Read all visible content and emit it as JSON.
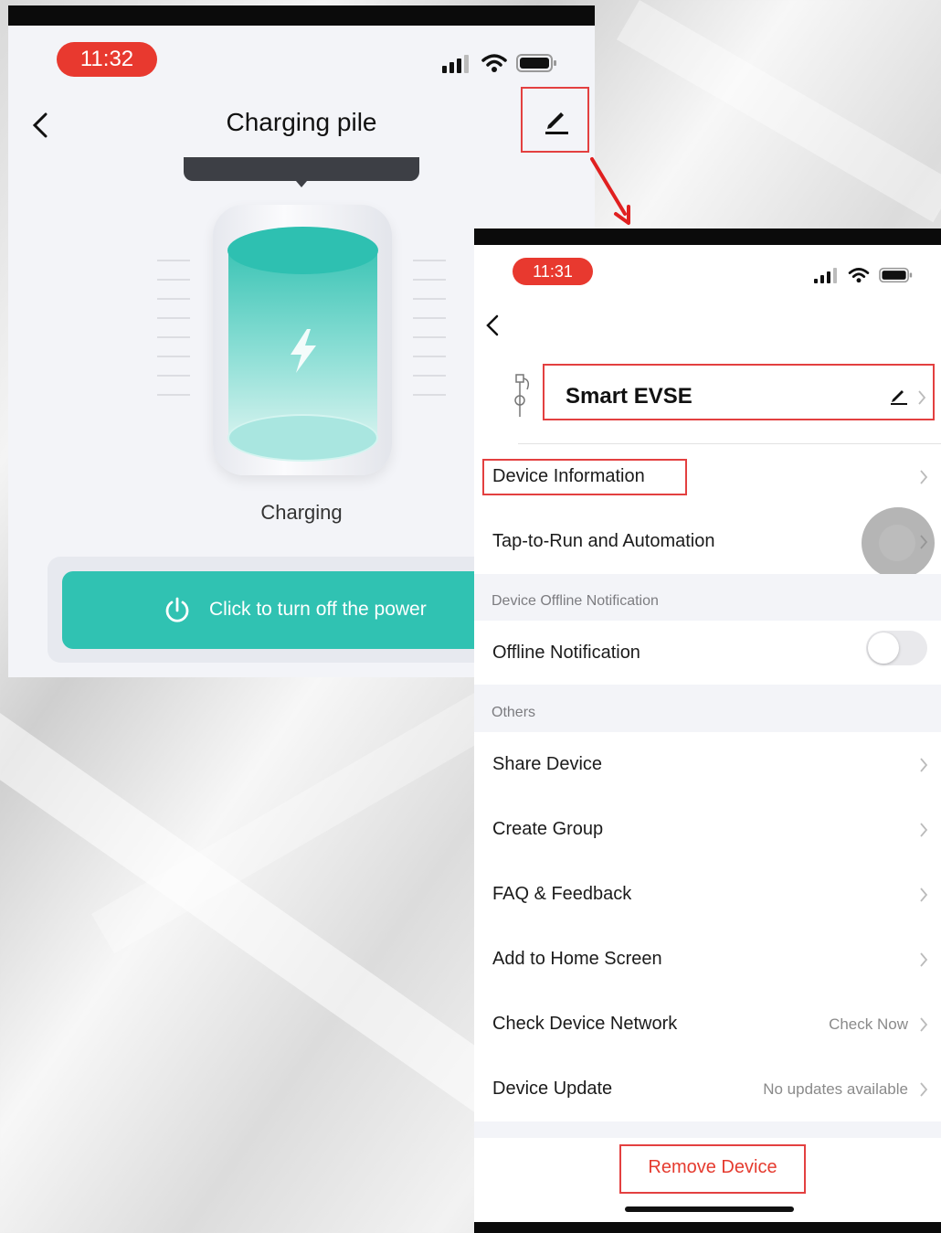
{
  "left_screen": {
    "time": "11:32",
    "title": "Charging pile",
    "status_label": "Charging",
    "power_button_label": "Click to turn off the power",
    "icons": [
      "back-icon",
      "edit-icon",
      "lightning-icon",
      "power-icon",
      "signal-icon",
      "wifi-icon",
      "battery-icon"
    ]
  },
  "right_screen": {
    "time": "11:31",
    "device_name": "Smart EVSE",
    "rows": {
      "device_information": "Device Information",
      "tap_to_run": "Tap-to-Run and Automation",
      "offline_notification": "Offline Notification",
      "share_device": "Share Device",
      "create_group": "Create Group",
      "faq": "FAQ & Feedback",
      "add_home": "Add to Home Screen",
      "check_network": "Check Device Network",
      "check_network_value": "Check Now",
      "device_update": "Device Update",
      "device_update_value": "No updates available"
    },
    "sections": {
      "offline": "Device Offline Notification",
      "others": "Others"
    },
    "offline_toggle_on": false,
    "remove_label": "Remove Device"
  },
  "colors": {
    "accent_teal": "#30c2b2",
    "highlight_red": "#e34040",
    "time_pill": "#e8392f",
    "remove_text": "#e53b2f"
  }
}
